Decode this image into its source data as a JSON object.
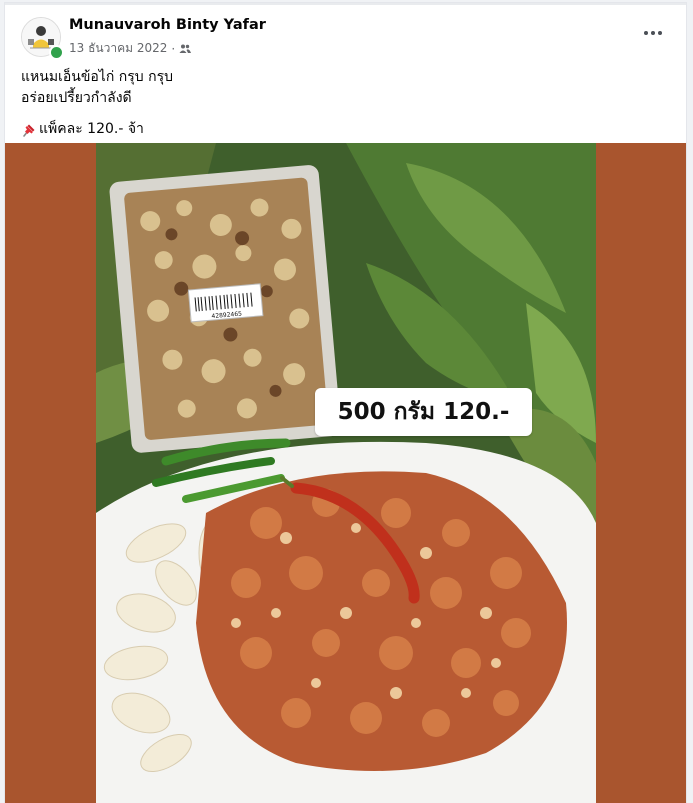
{
  "post": {
    "author_name": "Munauvaroh Binty Yafar",
    "date": "13 ธันวาคม 2022",
    "separator": "·",
    "audience_icon": "friends-icon",
    "more_icon": "more-options-icon",
    "text_line1": "แหนมเอ็นข้อไก่ กรุบ กรุบ",
    "text_line2": "อร่อยเปรี้ยวกำลังดี",
    "pin_icon": "pushpin-icon",
    "text_line3": "แพ็คละ 120.- จ้า"
  },
  "photo": {
    "price_label": "500 กรัม 120.-",
    "barcode_number": "42892465"
  },
  "colors": {
    "photo_border": "#a9552e",
    "online": "#31a24c",
    "chili": "#c0301c"
  }
}
